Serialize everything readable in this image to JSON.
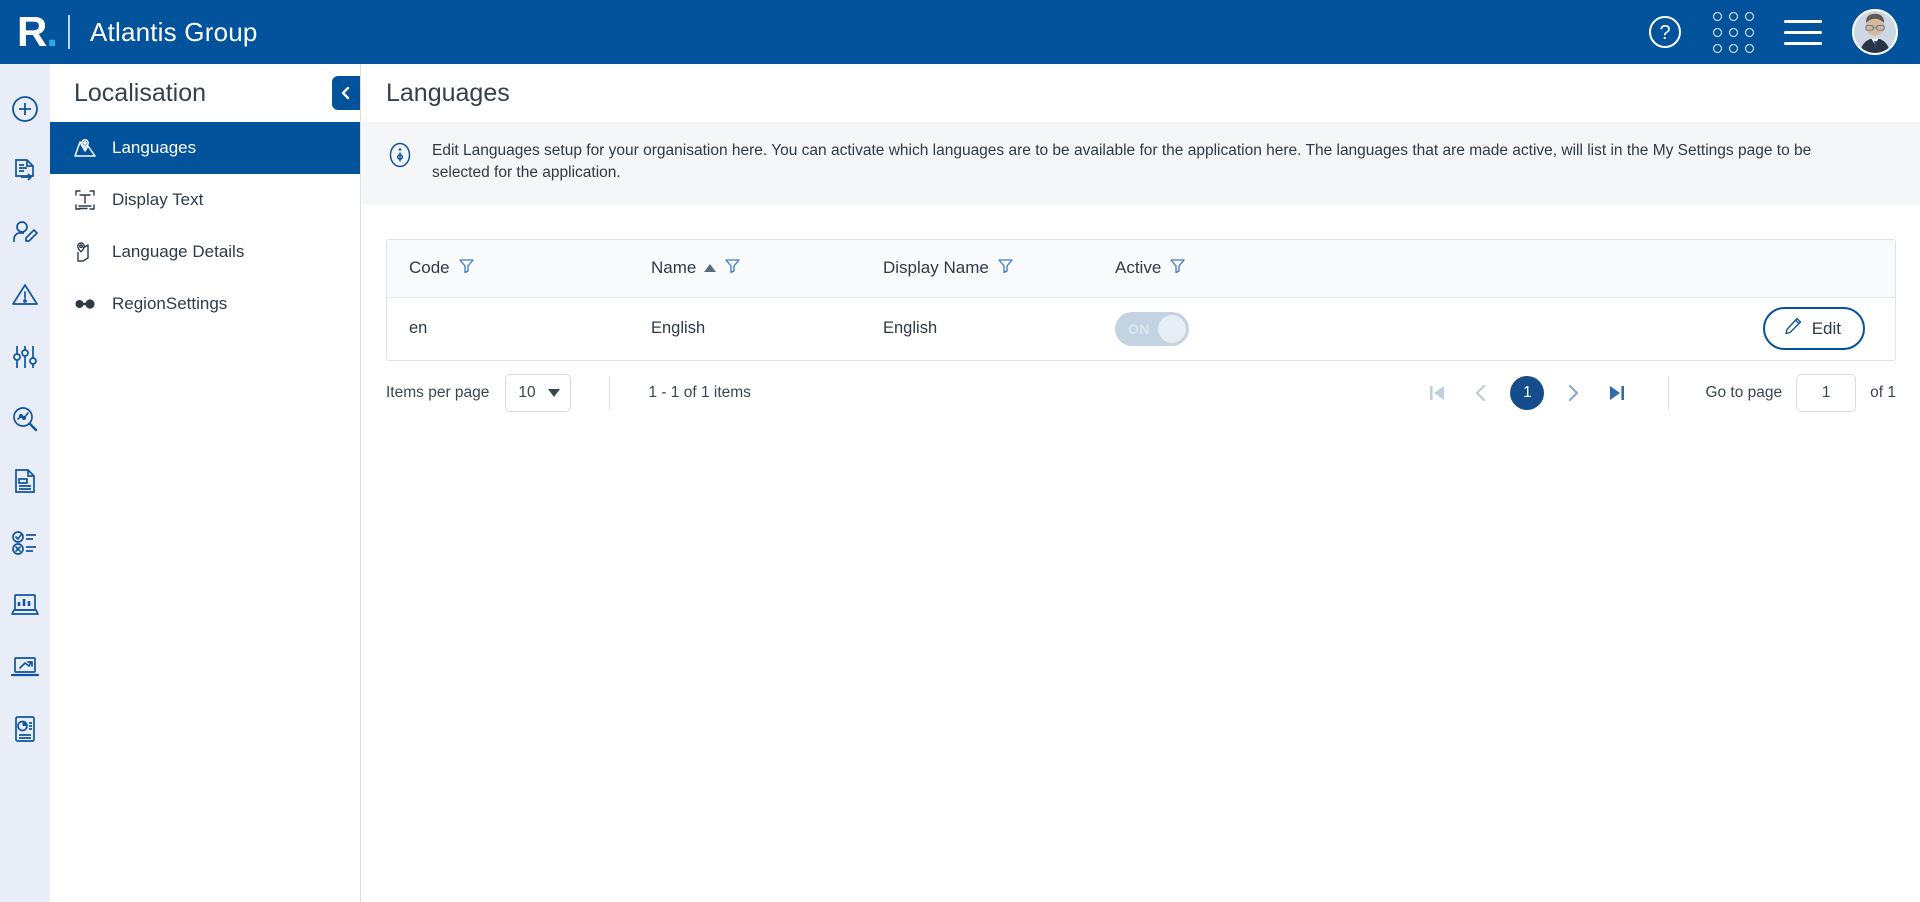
{
  "topbar": {
    "logo_letter": "R",
    "logo_dot": ".",
    "org_name": "Atlantis Group",
    "help_icon": "question-circle-icon",
    "apps_icon": "app-grid-icon",
    "menu_icon": "hamburger-menu-icon",
    "avatar_icon": "user-avatar"
  },
  "rail": {
    "items": [
      {
        "name": "add-new-icon"
      },
      {
        "name": "document-transfer-icon"
      },
      {
        "name": "user-edit-icon"
      },
      {
        "name": "warning-triangle-icon"
      },
      {
        "name": "settings-sliders-icon"
      },
      {
        "name": "analytics-search-icon"
      },
      {
        "name": "document-icon"
      },
      {
        "name": "checklist-icon"
      },
      {
        "name": "laptop-chart-icon"
      },
      {
        "name": "laptop-trend-icon"
      },
      {
        "name": "report-pie-icon"
      }
    ]
  },
  "panel": {
    "title": "Localisation",
    "collapse_icon": "chevron-left-icon",
    "items": [
      {
        "label": "Languages",
        "icon": "map-location-icon",
        "active": true
      },
      {
        "label": "Display Text",
        "icon": "text-frame-icon",
        "active": false
      },
      {
        "label": "Language Details",
        "icon": "map-pin-icon",
        "active": false
      },
      {
        "label": "RegionSettings",
        "icon": "dumbbell-icon",
        "active": false
      }
    ]
  },
  "page": {
    "title": "Languages",
    "info_icon": "info-circle-icon",
    "info_text": "Edit Languages setup for your organisation here. You can activate which languages are to be available for the application here. The languages that are made active, will list in the My Settings page to be selected for the application."
  },
  "table": {
    "columns": [
      {
        "label": "Code",
        "filter_icon": "filter-funnel-icon",
        "sorted": false
      },
      {
        "label": "Name",
        "filter_icon": "filter-funnel-icon",
        "sorted": true,
        "sort_dir": "asc"
      },
      {
        "label": "Display Name",
        "filter_icon": "filter-funnel-icon",
        "sorted": false
      },
      {
        "label": "Active",
        "filter_icon": "filter-funnel-icon",
        "sorted": false
      }
    ],
    "rows": [
      {
        "code": "en",
        "name": "English",
        "display_name": "English",
        "active_label": "ON",
        "active": true,
        "edit_label": "Edit",
        "edit_icon": "pencil-icon"
      }
    ]
  },
  "pagination": {
    "items_per_page_label": "Items per page",
    "items_per_page_value": "10",
    "range_text": "1 - 1 of 1 items",
    "first_icon": "page-first-icon",
    "prev_icon": "page-prev-icon",
    "current_page": "1",
    "next_icon": "page-next-icon",
    "last_icon": "page-last-icon",
    "goto_label": "Go to page",
    "goto_value": "1",
    "of_label": "of 1"
  },
  "colors": {
    "brand_blue": "#02529C",
    "accent_cyan": "#29ABE2",
    "rail_bg": "#E8EDF7",
    "pager_active": "#154C8C"
  }
}
